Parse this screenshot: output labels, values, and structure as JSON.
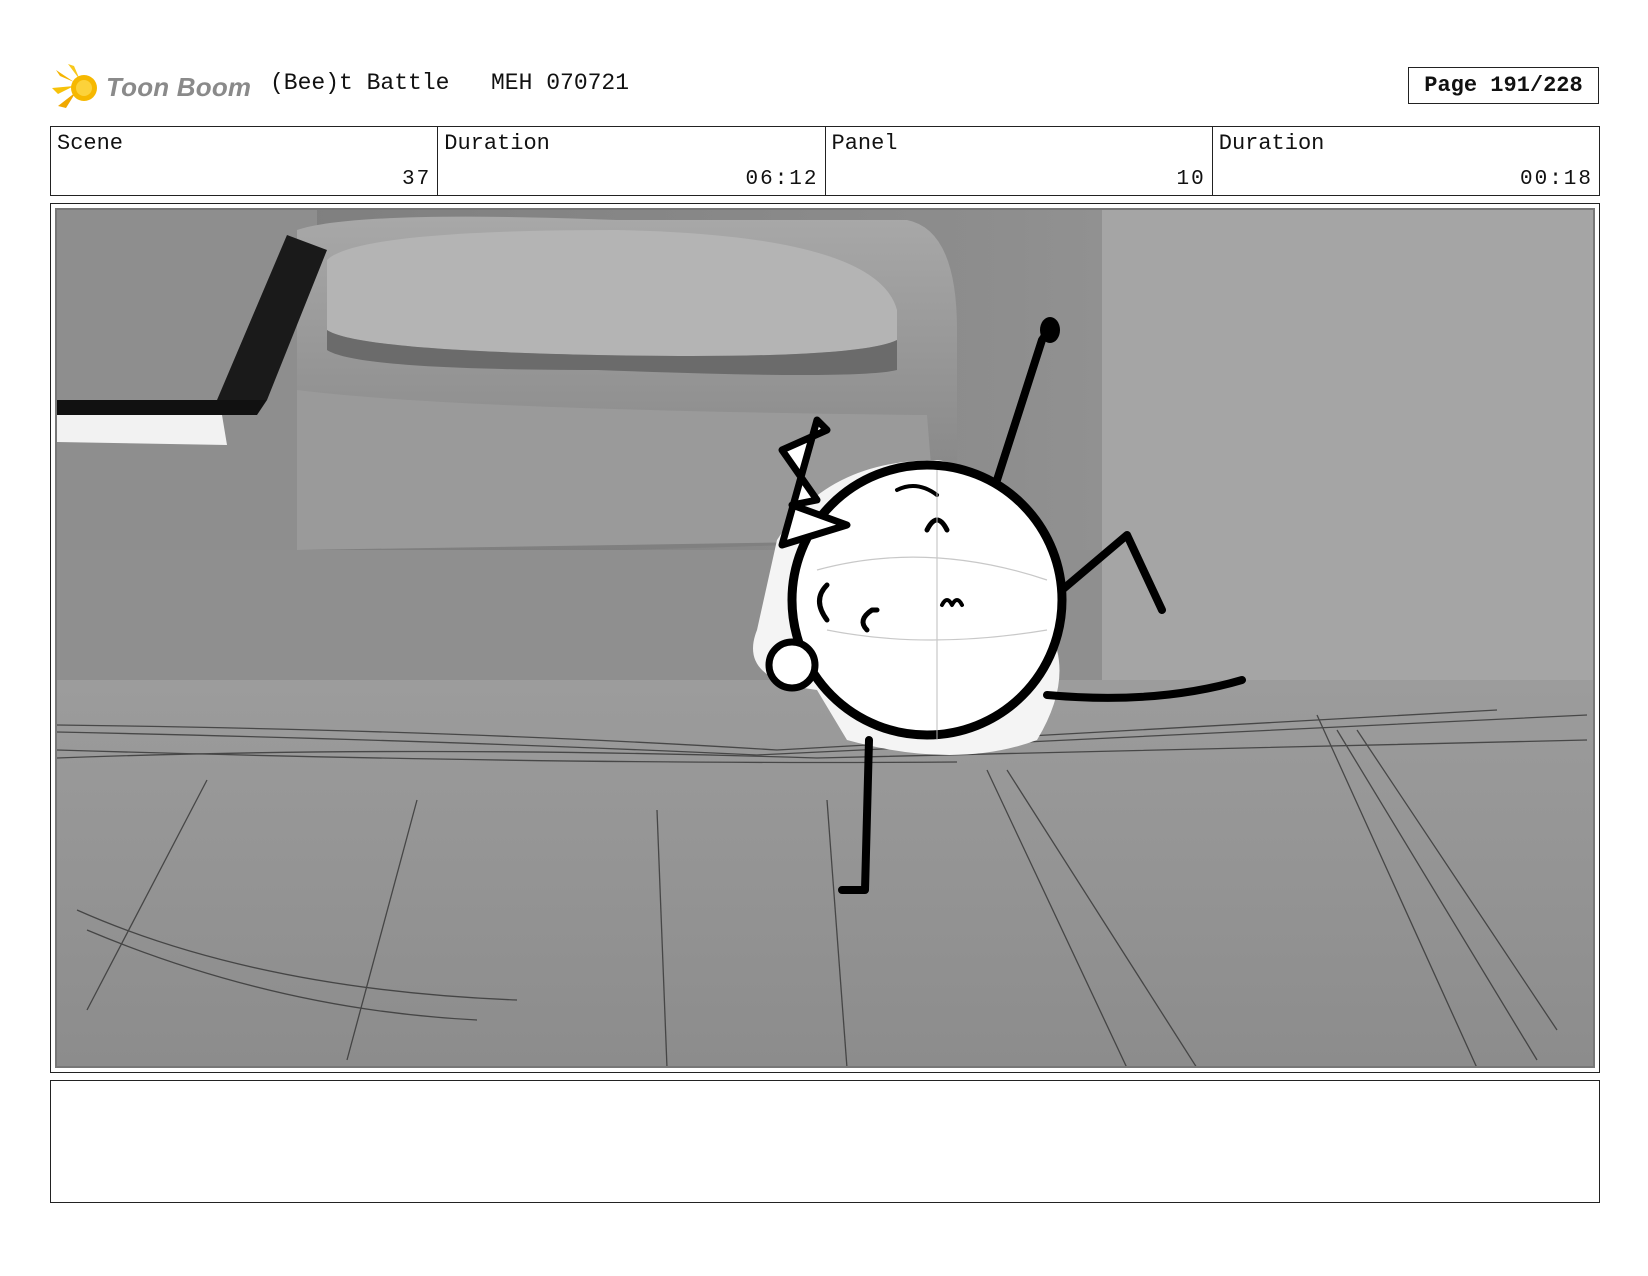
{
  "header": {
    "logo_text": "Toon Boom",
    "title": "(Bee)t Battle",
    "code": "MEH 070721",
    "page": "Page 191/228"
  },
  "info": {
    "scene_label": "Scene",
    "scene_value": "37",
    "scene_duration_label": "Duration",
    "scene_duration_value": "06:12",
    "panel_label": "Panel",
    "panel_value": "10",
    "panel_duration_label": "Duration",
    "panel_duration_value": "00:18"
  },
  "panel_image": {
    "description_icon": "storyboard-sketch-character-handstand"
  },
  "notes": {
    "text": ""
  }
}
